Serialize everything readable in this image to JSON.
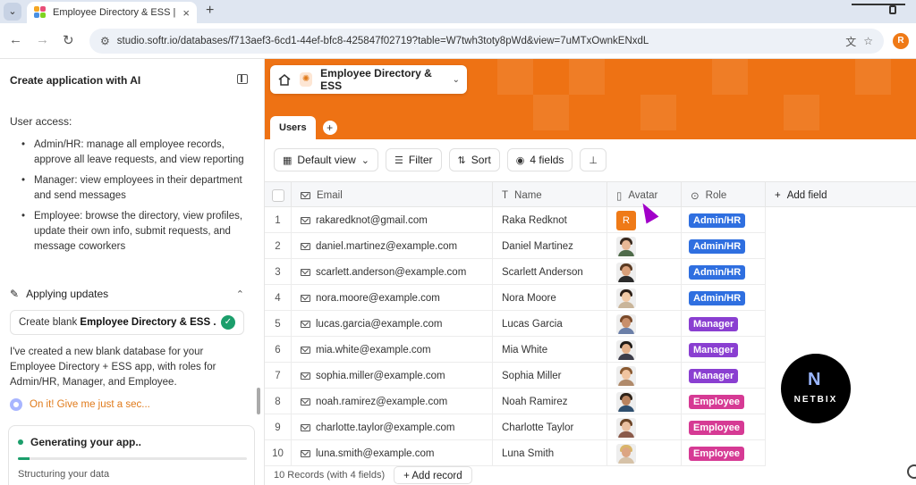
{
  "browser": {
    "tab_title": "Employee Directory & ESS | Softr",
    "tab_close": "×",
    "new_tab": "+",
    "url": "studio.softr.io/databases/f713aef3-6cd1-44ef-bfc8-425847f02719?table=W7twh3toty8pWd&view=7uMTxOwnkENxdL",
    "profile_initial": "R"
  },
  "left_panel": {
    "title": "Create application with AI",
    "access_heading": "User access:",
    "access_items": [
      "Admin/HR: manage all employee records, approve all leave requests, and view reporting",
      "Manager: view employees in their department and send messages",
      "Employee: browse the directory, view profiles, update their own info, submit requests, and message coworkers"
    ],
    "applying_label": "Applying updates",
    "create_prefix": "Create blank ",
    "create_bold": "Employee Directory & ESS ...",
    "created_message": "I've created a new blank database for your Employee Directory + ESS app, with roles for Admin/HR, Manager, and Employee.",
    "on_it": "On it! Give me just a sec...",
    "generating_title": "Generating your app..",
    "generating_progress": 0.05,
    "generating_sub": "Structuring your data"
  },
  "app": {
    "name": "Employee Directory & ESS",
    "tab_users": "Users",
    "brand_color": "#ee7214"
  },
  "toolbar": {
    "view": "Default view",
    "filter": "Filter",
    "sort": "Sort",
    "fields": "4 fields"
  },
  "table": {
    "columns": [
      "Email",
      "Name",
      "Avatar",
      "Role"
    ],
    "add_field": "Add field",
    "rows": [
      {
        "num": "1",
        "email": "rakaredknot@gmail.com",
        "name": "Raka Redknot",
        "avatar": "R",
        "role": "Admin/HR"
      },
      {
        "num": "2",
        "email": "daniel.martinez@example.com",
        "name": "Daniel Martinez",
        "avatar": "",
        "role": "Admin/HR"
      },
      {
        "num": "3",
        "email": "scarlett.anderson@example.com",
        "name": "Scarlett Anderson",
        "avatar": "",
        "role": "Admin/HR"
      },
      {
        "num": "4",
        "email": "nora.moore@example.com",
        "name": "Nora Moore",
        "avatar": "",
        "role": "Admin/HR"
      },
      {
        "num": "5",
        "email": "lucas.garcia@example.com",
        "name": "Lucas Garcia",
        "avatar": "",
        "role": "Manager"
      },
      {
        "num": "6",
        "email": "mia.white@example.com",
        "name": "Mia White",
        "avatar": "",
        "role": "Manager"
      },
      {
        "num": "7",
        "email": "sophia.miller@example.com",
        "name": "Sophia Miller",
        "avatar": "",
        "role": "Manager"
      },
      {
        "num": "8",
        "email": "noah.ramirez@example.com",
        "name": "Noah Ramirez",
        "avatar": "",
        "role": "Employee"
      },
      {
        "num": "9",
        "email": "charlotte.taylor@example.com",
        "name": "Charlotte Taylor",
        "avatar": "",
        "role": "Employee"
      },
      {
        "num": "10",
        "email": "luna.smith@example.com",
        "name": "Luna Smith",
        "avatar": "",
        "role": "Employee"
      }
    ],
    "role_colors": {
      "Admin/HR": "#2f6fe0",
      "Manager": "#8a3fd1",
      "Employee": "#d63a94"
    },
    "footer_count": "10 Records (with 4 fields)",
    "add_record": "+ Add record"
  },
  "watermark": {
    "text": "NETBIX"
  }
}
